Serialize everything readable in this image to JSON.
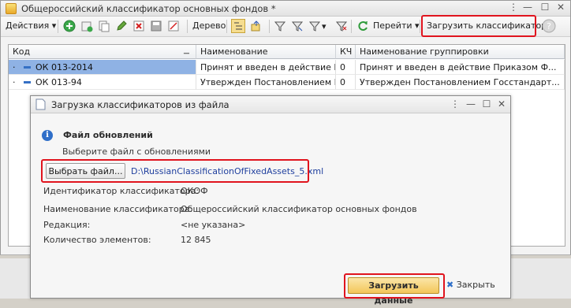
{
  "main_window": {
    "title": "Общероссийский классификатор основных фондов *",
    "ctrl": {
      "menu": "⋮",
      "minimize": "—",
      "maximize": "☐",
      "close": "✕"
    }
  },
  "toolbar": {
    "actions_label": "Действия",
    "tree_label": "Дерево",
    "goto_label": "Перейти",
    "load_classifier_label": "Загрузить классификатор",
    "dropdown_arrow": "▾"
  },
  "grid": {
    "columns": [
      "Код",
      "Наименование",
      "КЧ",
      "Наименование группировки"
    ],
    "rows": [
      {
        "code": "ОК 013-2014",
        "name": "Принят и введен в действие Пр...",
        "kch": "0",
        "group": "Принят и введен в действие Приказом Ф..."
      },
      {
        "code": "ОК 013-94",
        "name": "Утвержден Постановлением Го...",
        "kch": "0",
        "group": "Утвержден Постановлением Госстандарт..."
      }
    ]
  },
  "dialog": {
    "title": "Загрузка классификаторов из файла",
    "ctrl": {
      "menu": "⋮",
      "minimize": "—",
      "maximize": "☐",
      "close": "✕"
    },
    "info_icon": "i",
    "section_title": "Файл обновлений",
    "hint": "Выберите файл с обновлениями",
    "choose_file_label": "Выбрать файл...",
    "file_path": "D:\\RussianClassificationOfFixedAssets_5.xml",
    "fields": [
      {
        "label": "Идентификатор классификатора:",
        "value": "ОКОФ"
      },
      {
        "label": "Наименование классификатора:",
        "value": "Общероссийский классификатор основных фондов"
      },
      {
        "label": "Редакция:",
        "value": "<не указана>"
      },
      {
        "label": "Количество элементов:",
        "value": "12 845"
      }
    ],
    "load_data_label": "Загрузить данные",
    "close_label": "Закрыть",
    "close_icon": "✖"
  },
  "colors": {
    "highlight": "#e0141e",
    "selection": "#a8c4ea",
    "link": "#1f3f9e"
  }
}
